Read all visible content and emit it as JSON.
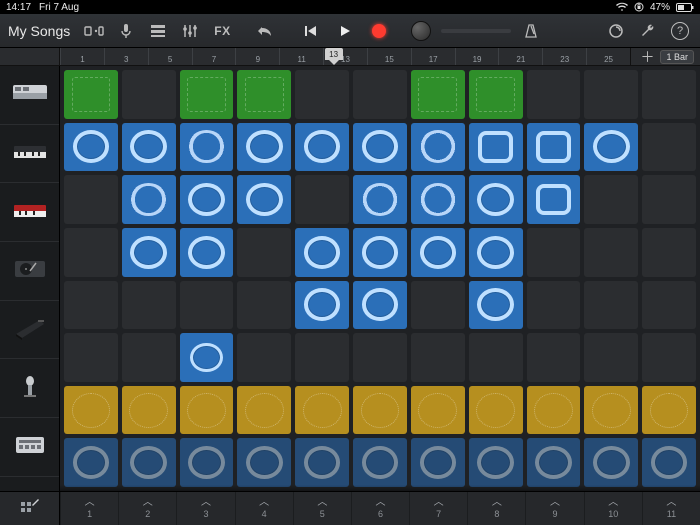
{
  "status": {
    "time": "14:17",
    "date": "Fri 7 Aug",
    "battery_pct": "47%"
  },
  "toolbar": {
    "back_label": "My Songs",
    "fx_label": "FX"
  },
  "ruler": {
    "ticks": [
      "1",
      "3",
      "5",
      "7",
      "9",
      "11",
      "13",
      "15",
      "17",
      "19",
      "21",
      "23",
      "25"
    ],
    "playhead_beat": "13",
    "section_label": "1 Bar"
  },
  "tracks": [
    {
      "name": "synth"
    },
    {
      "name": "keyboard"
    },
    {
      "name": "keys-red"
    },
    {
      "name": "turntable"
    },
    {
      "name": "piano"
    },
    {
      "name": "microphone"
    },
    {
      "name": "drum-machine"
    }
  ],
  "grid": {
    "cols": 11,
    "rows": 8,
    "cells": [
      {
        "r": 1,
        "c": 1,
        "t": "green"
      },
      {
        "r": 1,
        "c": 3,
        "t": "green"
      },
      {
        "r": 1,
        "c": 4,
        "t": "green"
      },
      {
        "r": 1,
        "c": 7,
        "t": "green"
      },
      {
        "r": 1,
        "c": 8,
        "t": "green"
      },
      {
        "r": 2,
        "c": 1,
        "t": "blue"
      },
      {
        "r": 2,
        "c": 2,
        "t": "blue"
      },
      {
        "r": 2,
        "c": 3,
        "t": "blue",
        "v": "fuzz"
      },
      {
        "r": 2,
        "c": 4,
        "t": "blue"
      },
      {
        "r": 2,
        "c": 5,
        "t": "blue"
      },
      {
        "r": 2,
        "c": 6,
        "t": "blue"
      },
      {
        "r": 2,
        "c": 7,
        "t": "blue",
        "v": "fuzz"
      },
      {
        "r": 2,
        "c": 8,
        "t": "blue",
        "v": "sq"
      },
      {
        "r": 2,
        "c": 9,
        "t": "blue",
        "v": "sq"
      },
      {
        "r": 2,
        "c": 10,
        "t": "blue"
      },
      {
        "r": 3,
        "c": 2,
        "t": "blue",
        "v": "fuzz"
      },
      {
        "r": 3,
        "c": 3,
        "t": "blue"
      },
      {
        "r": 3,
        "c": 4,
        "t": "blue"
      },
      {
        "r": 3,
        "c": 6,
        "t": "blue",
        "v": "fuzz"
      },
      {
        "r": 3,
        "c": 7,
        "t": "blue",
        "v": "fuzz"
      },
      {
        "r": 3,
        "c": 8,
        "t": "blue"
      },
      {
        "r": 3,
        "c": 9,
        "t": "blue",
        "v": "sq"
      },
      {
        "r": 4,
        "c": 2,
        "t": "blue"
      },
      {
        "r": 4,
        "c": 3,
        "t": "blue"
      },
      {
        "r": 4,
        "c": 5,
        "t": "blue"
      },
      {
        "r": 4,
        "c": 6,
        "t": "blue"
      },
      {
        "r": 4,
        "c": 7,
        "t": "blue"
      },
      {
        "r": 4,
        "c": 8,
        "t": "blue"
      },
      {
        "r": 5,
        "c": 5,
        "t": "blue"
      },
      {
        "r": 5,
        "c": 6,
        "t": "blue"
      },
      {
        "r": 5,
        "c": 8,
        "t": "blue"
      },
      {
        "r": 6,
        "c": 3,
        "t": "blue",
        "v": "alt"
      },
      {
        "r": 7,
        "c": 1,
        "t": "yellow"
      },
      {
        "r": 7,
        "c": 2,
        "t": "yellow"
      },
      {
        "r": 7,
        "c": 3,
        "t": "yellow"
      },
      {
        "r": 7,
        "c": 4,
        "t": "yellow"
      },
      {
        "r": 7,
        "c": 5,
        "t": "yellow"
      },
      {
        "r": 7,
        "c": 6,
        "t": "yellow"
      },
      {
        "r": 7,
        "c": 7,
        "t": "yellow"
      },
      {
        "r": 7,
        "c": 8,
        "t": "yellow"
      },
      {
        "r": 7,
        "c": 9,
        "t": "yellow"
      },
      {
        "r": 7,
        "c": 10,
        "t": "yellow"
      },
      {
        "r": 7,
        "c": 11,
        "t": "yellow"
      },
      {
        "r": 8,
        "c": 1,
        "t": "blue",
        "dim": true
      },
      {
        "r": 8,
        "c": 2,
        "t": "blue",
        "dim": true
      },
      {
        "r": 8,
        "c": 3,
        "t": "blue",
        "dim": true
      },
      {
        "r": 8,
        "c": 4,
        "t": "blue",
        "dim": true
      },
      {
        "r": 8,
        "c": 5,
        "t": "blue",
        "dim": true
      },
      {
        "r": 8,
        "c": 6,
        "t": "blue",
        "dim": true
      },
      {
        "r": 8,
        "c": 7,
        "t": "blue",
        "dim": true
      },
      {
        "r": 8,
        "c": 8,
        "t": "blue",
        "dim": true
      },
      {
        "r": 8,
        "c": 9,
        "t": "blue",
        "dim": true
      },
      {
        "r": 8,
        "c": 10,
        "t": "blue",
        "dim": true
      },
      {
        "r": 8,
        "c": 11,
        "t": "blue",
        "dim": true
      }
    ]
  },
  "triggers": [
    "1",
    "2",
    "3",
    "4",
    "5",
    "6",
    "7",
    "8",
    "9",
    "10",
    "11"
  ]
}
